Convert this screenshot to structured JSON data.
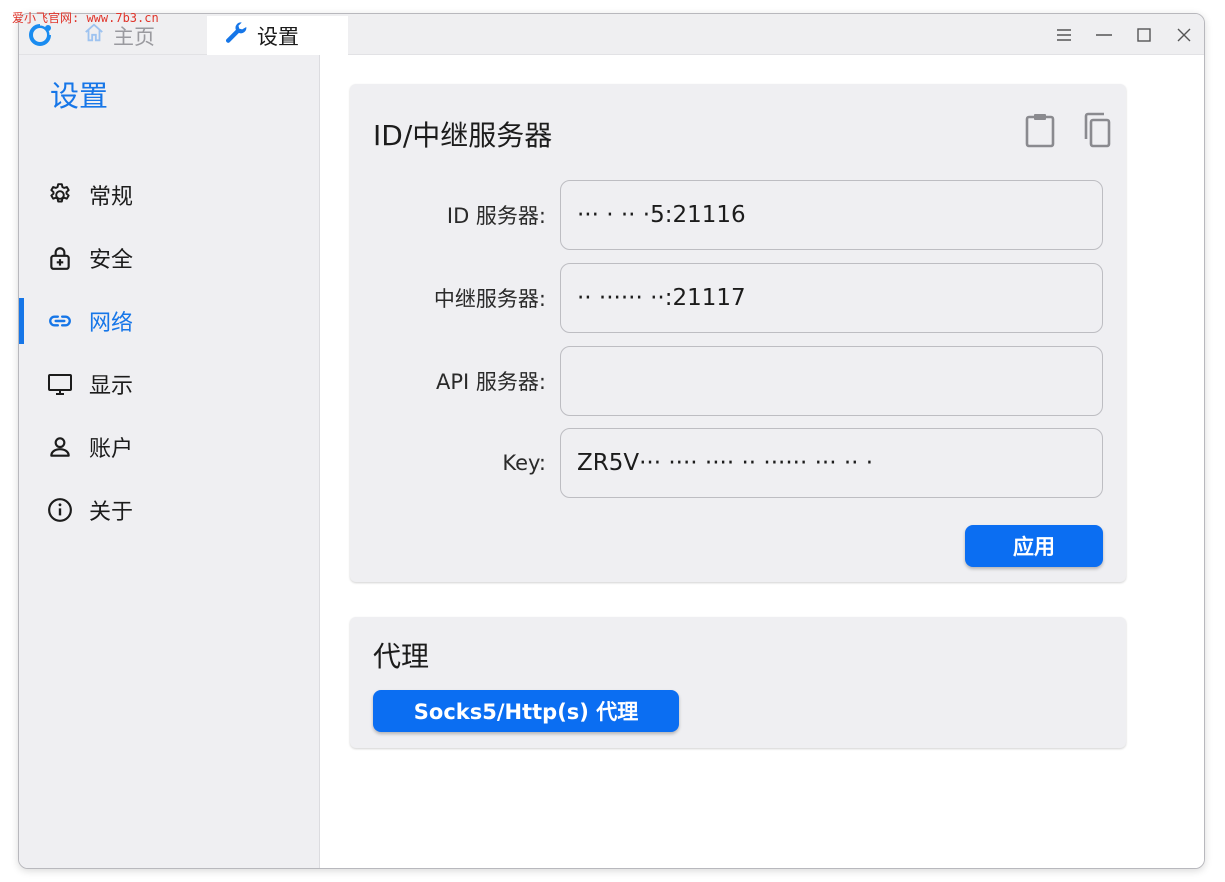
{
  "watermark": "爱小飞官网: www.7b3.cn",
  "titlebar": {
    "tabs": [
      {
        "label": "主页",
        "icon": "home-icon"
      },
      {
        "label": "设置",
        "icon": "wrench-icon"
      }
    ]
  },
  "sidebar": {
    "title": "设置",
    "items": [
      {
        "label": "常规",
        "icon": "gear-icon"
      },
      {
        "label": "安全",
        "icon": "lock-icon"
      },
      {
        "label": "网络",
        "icon": "link-icon",
        "active": true
      },
      {
        "label": "显示",
        "icon": "monitor-icon"
      },
      {
        "label": "账户",
        "icon": "person-icon"
      },
      {
        "label": "关于",
        "icon": "info-icon"
      }
    ]
  },
  "id_server_card": {
    "title": "ID/中继服务器",
    "fields": [
      {
        "label": "ID 服务器:",
        "value": "··· · ·· ·5:21116"
      },
      {
        "label": "中继服务器:",
        "value": "·· ······ ··:21117"
      },
      {
        "label": "API 服务器:",
        "value": ""
      },
      {
        "label": "Key:",
        "value": "ZR5V··· ···· ···· ·· ······ ··· ·· ·"
      }
    ],
    "apply_label": "应用"
  },
  "proxy_card": {
    "title": "代理",
    "button_label": "Socks5/Http(s) 代理"
  },
  "colors": {
    "accent": "#1676e8",
    "button": "#0b6ef2",
    "card_bg": "#efeff2"
  }
}
